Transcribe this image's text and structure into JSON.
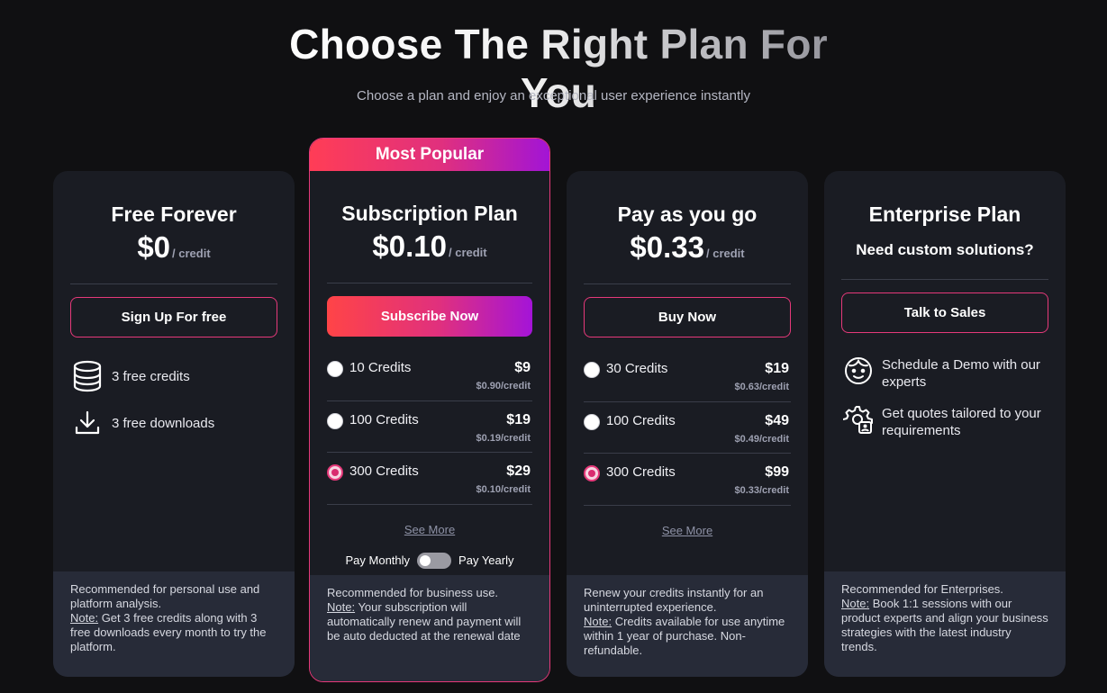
{
  "header": {
    "title": "Choose The Right Plan For You",
    "subtitle": "Choose a plan and enjoy an exceptional user experience instantly"
  },
  "plans": [
    {
      "title": "Free Forever",
      "price": "$0",
      "unit": "/ credit",
      "cta": "Sign Up For free",
      "features": [
        {
          "icon": "database-icon",
          "text": "3 free credits"
        },
        {
          "icon": "download-icon",
          "text": "3 free downloads"
        }
      ],
      "footer": {
        "line1": "Recommended for personal use and platform analysis.",
        "note_label": "Note:",
        "note": " Get 3 free credits along with 3 free downloads every month to try the platform."
      }
    },
    {
      "ribbon": "Most Popular",
      "title": "Subscription Plan",
      "price": "$0.10",
      "unit": "/ credit",
      "cta": "Subscribe Now",
      "options": [
        {
          "label": "10 Credits",
          "price": "$9",
          "per": "$0.90/credit",
          "selected": false
        },
        {
          "label": "100 Credits",
          "price": "$19",
          "per": "$0.19/credit",
          "selected": false
        },
        {
          "label": "300 Credits",
          "price": "$29",
          "per": "$0.10/credit",
          "selected": true
        }
      ],
      "see_more": "See More",
      "toggle": {
        "left": "Pay Monthly",
        "right": "Pay Yearly"
      },
      "footer": {
        "line1": "Recommended for business use.",
        "note_label": "Note:",
        "note": " Your subscription will automatically renew and payment will be auto deducted at the renewal date"
      }
    },
    {
      "title": "Pay as you go",
      "price": "$0.33",
      "unit": "/ credit",
      "cta": "Buy Now",
      "options": [
        {
          "label": "30 Credits",
          "price": "$19",
          "per": "$0.63/credit",
          "selected": false
        },
        {
          "label": "100 Credits",
          "price": "$49",
          "per": "$0.49/credit",
          "selected": false
        },
        {
          "label": "300 Credits",
          "price": "$99",
          "per": "$0.33/credit",
          "selected": true
        }
      ],
      "see_more": "See More",
      "footer": {
        "line1": "Renew your credits instantly for an uninterrupted experience.",
        "note_label": "Note:",
        "note": " Credits available for use anytime within 1 year of purchase. Non-refundable."
      }
    },
    {
      "title": "Enterprise Plan",
      "subtitle": "Need custom solutions?",
      "cta": "Talk to Sales",
      "features": [
        {
          "icon": "smiley-face-icon",
          "text": "Schedule a Demo with our experts"
        },
        {
          "icon": "user-gear-icon",
          "text": "Get quotes tailored to your requirements"
        }
      ],
      "footer": {
        "line1": "Recommended for Enterprises.",
        "note_label": "Note:",
        "note": " Book 1:1 sessions with our product experts and align your business strategies with the latest industry trends."
      }
    }
  ],
  "colors": {
    "background": "#101012",
    "card": "#1a1c23",
    "footer": "#272b38",
    "accent_pink": "#e6397a",
    "gradient_start": "#ff4447",
    "gradient_end": "#a414d8"
  }
}
